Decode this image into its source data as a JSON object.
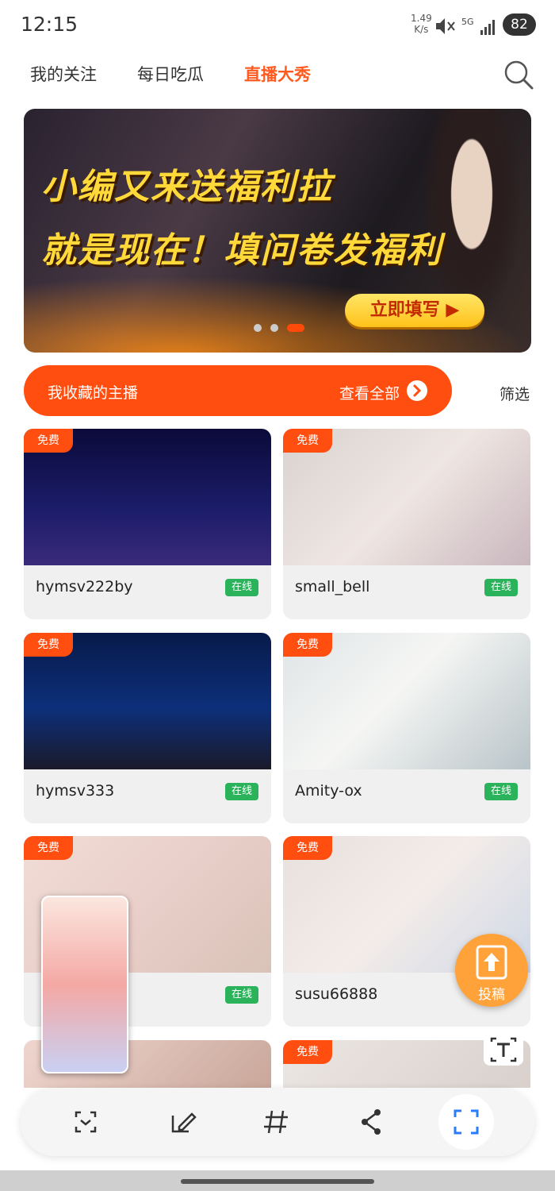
{
  "status": {
    "time": "12:15",
    "net_speed": "1.49",
    "net_unit": "K/s",
    "network": "5G",
    "battery": "82"
  },
  "tabs": [
    {
      "label": "我的关注",
      "active": false
    },
    {
      "label": "每日吃瓜",
      "active": false
    },
    {
      "label": "直播大秀",
      "active": true
    }
  ],
  "banner": {
    "line1": "小编又来送福利拉",
    "line2": "就是现在！填问卷发福利",
    "cta": "立即填写 ▶",
    "page": 3,
    "pages": 3
  },
  "favorites": {
    "title": "我收藏的主播",
    "view_all": "查看全部",
    "filter": "筛选"
  },
  "streams": [
    {
      "name": "hymsv222by",
      "badge": "免费",
      "status": "在线"
    },
    {
      "name": "small_bell",
      "badge": "免费",
      "status": "在线"
    },
    {
      "name": "hymsv333",
      "badge": "免费",
      "status": "在线"
    },
    {
      "name": "Amity-ox",
      "badge": "免费",
      "status": "在线"
    },
    {
      "name": "",
      "badge": "免费",
      "status": "在线"
    },
    {
      "name": "susu66888",
      "badge": "免费",
      "status": ""
    },
    {
      "name": "",
      "badge": "",
      "status": ""
    },
    {
      "name": "",
      "badge": "免费",
      "status": ""
    }
  ],
  "float_button": {
    "label": "投稿"
  },
  "toolbar": {
    "items": [
      "scan-text",
      "edit",
      "hashtag",
      "share",
      "screenshot"
    ]
  },
  "colors": {
    "accent": "#ff4e10",
    "online": "#2bb35b",
    "tab_active": "#ff5a1f"
  }
}
